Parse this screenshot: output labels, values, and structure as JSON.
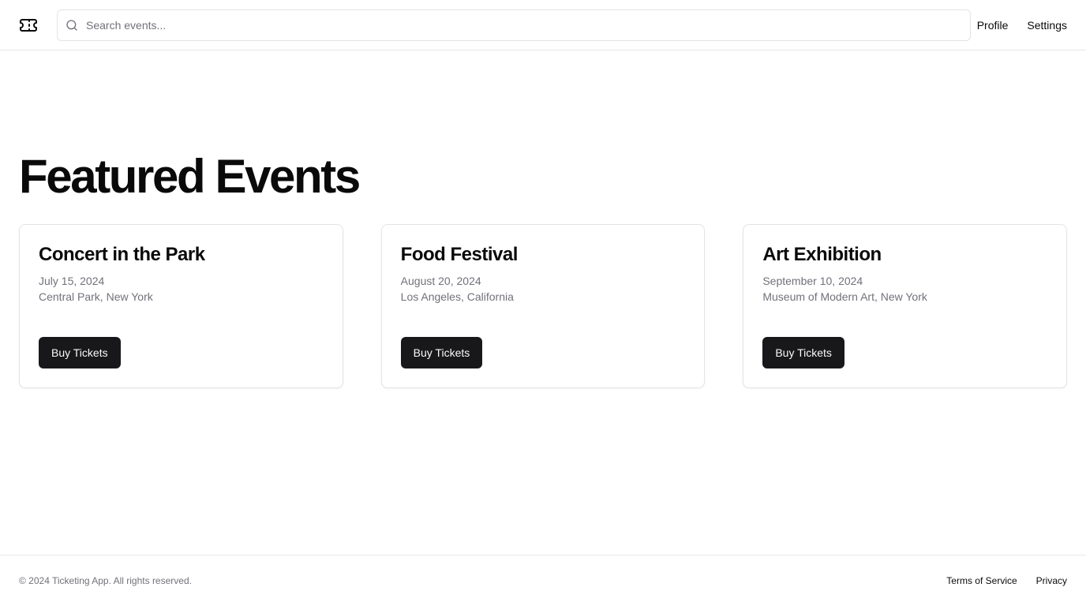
{
  "header": {
    "logo_icon": "ticket-icon",
    "search": {
      "placeholder": "Search events...",
      "value": "",
      "icon": "search-icon"
    },
    "nav": [
      {
        "label": "Profile"
      },
      {
        "label": "Settings"
      }
    ]
  },
  "main": {
    "title": "Featured Events",
    "events": [
      {
        "title": "Concert in the Park",
        "date": "July 15, 2024",
        "location": "Central Park, New York",
        "button_label": "Buy Tickets"
      },
      {
        "title": "Food Festival",
        "date": "August 20, 2024",
        "location": "Los Angeles, California",
        "button_label": "Buy Tickets"
      },
      {
        "title": "Art Exhibition",
        "date": "September 10, 2024",
        "location": "Museum of Modern Art, New York",
        "button_label": "Buy Tickets"
      }
    ]
  },
  "footer": {
    "copyright": "© 2024 Ticketing App. All rights reserved.",
    "links": [
      {
        "label": "Terms of Service"
      },
      {
        "label": "Privacy"
      }
    ]
  },
  "colors": {
    "primary_button": "#18181b",
    "muted_text": "#71717a",
    "border": "#e4e4e7"
  }
}
